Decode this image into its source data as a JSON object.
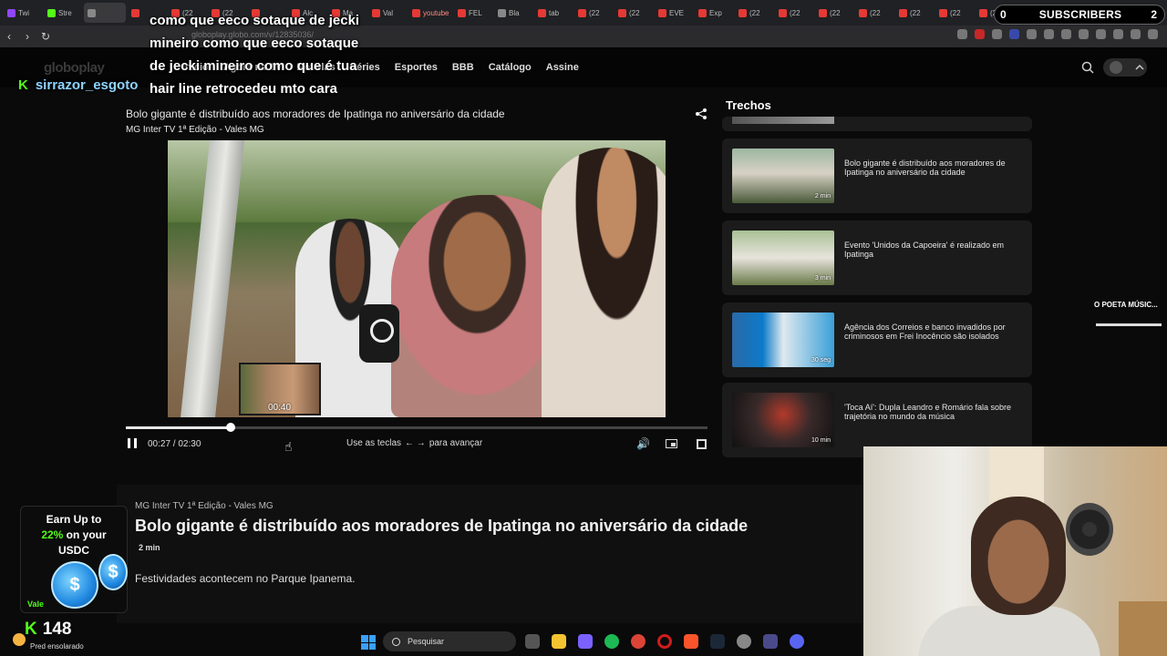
{
  "browser": {
    "tabs": [
      {
        "label": "Twi",
        "color": "#9146ff"
      },
      {
        "label": "Stre",
        "color": "#53fc18"
      },
      {
        "label": "",
        "color": "#888888"
      },
      {
        "label": "",
        "color": "#e53935"
      },
      {
        "label": "(22",
        "color": "#e53935"
      },
      {
        "label": "(22",
        "color": "#e53935"
      },
      {
        "label": "",
        "color": "#e53935"
      },
      {
        "label": "Alc",
        "color": "#e53935"
      },
      {
        "label": "Ma",
        "color": "#e53935"
      },
      {
        "label": "Val",
        "color": "#e53935"
      },
      {
        "label": "youtube",
        "color": "#e53935"
      },
      {
        "label": "FEL",
        "color": "#e53935"
      },
      {
        "label": "Bla",
        "color": "#888888"
      },
      {
        "label": "tab",
        "color": "#e53935"
      },
      {
        "label": "(22",
        "color": "#e53935"
      },
      {
        "label": "(22",
        "color": "#e53935"
      },
      {
        "label": "EVE",
        "color": "#e53935"
      },
      {
        "label": "Exp",
        "color": "#e53935"
      },
      {
        "label": "(22",
        "color": "#e53935"
      },
      {
        "label": "(22",
        "color": "#e53935"
      },
      {
        "label": "(22",
        "color": "#e53935"
      },
      {
        "label": "(22",
        "color": "#e53935"
      },
      {
        "label": "(22",
        "color": "#e53935"
      },
      {
        "label": "(22",
        "color": "#e53935"
      },
      {
        "label": "(22",
        "color": "#e53935"
      }
    ],
    "url": "globoplay.globo.com/v/12835036/"
  },
  "subscribers_widget": {
    "left": "0",
    "label": "SUBSCRIBERS",
    "right": "2"
  },
  "stream_chat": {
    "overlay_message": "como que eeco sotaque de jecki mineiro como que eeco sotaque de jecki mineiro como que é tua hair line retrocedeu mto cara",
    "username": "sirrazor_esgoto"
  },
  "site": {
    "logo": "globoplay",
    "nav": [
      "Início",
      "Agora na TV",
      "Novelas",
      "Séries",
      "Esportes",
      "BBB",
      "Catálogo",
      "Assine"
    ]
  },
  "player": {
    "title": "Bolo gigante é distribuído aos moradores de Ipatinga no aniversário da cidade",
    "program": "MG Inter TV 1ª Edição - Vales MG",
    "current_time": "00:27",
    "total_time": "02:30",
    "hint_prefix": "Use as teclas",
    "hint_arrows": "← →",
    "hint_suffix": "para avançar",
    "preview_time": "00:40",
    "progress_fraction": 0.18,
    "preview_fraction": 0.267
  },
  "trechos": {
    "heading": "Trechos",
    "items": [
      {
        "title": "Bolo gigante é distribuído aos moradores de Ipatinga no aniversário da cidade",
        "duration": "2 min"
      },
      {
        "title": "Evento 'Unidos da Capoeira' é realizado em Ipatinga",
        "duration": "3 min"
      },
      {
        "title": "Agência dos Correios e banco invadidos por criminosos em Frei Inocêncio são isolados",
        "duration": "30 seg"
      },
      {
        "title": "'Toca Aí': Dupla Leandro e Romário fala sobre trajetória no mundo da música",
        "duration": "10 min"
      }
    ]
  },
  "side_widget": {
    "title": "O POETA MÚSIC...",
    "progress_fraction": 1.0
  },
  "info": {
    "program": "MG Inter TV 1ª Edição - Vales MG",
    "title": "Bolo gigante é distribuído aos moradores de Ipatinga no aniversário da cidade",
    "duration": "2 min",
    "description": "Festividades acontecem no Parque Ipanema."
  },
  "promo": {
    "line1": "Earn Up to",
    "line2_highlight": "22%",
    "line2_rest": " on your",
    "line3": "USDC",
    "footer": "Vale"
  },
  "stream_stats": {
    "viewers": "148",
    "weather": "Pred ensolarado"
  },
  "taskbar": {
    "search_placeholder": "Pesquisar"
  }
}
